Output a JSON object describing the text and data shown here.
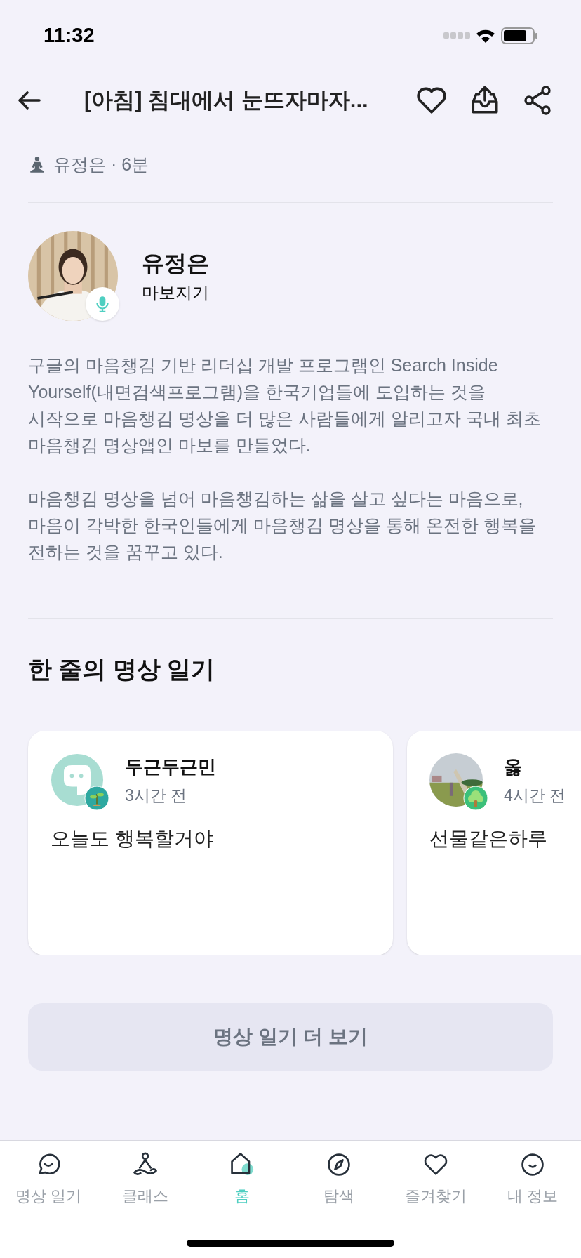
{
  "status_bar": {
    "time": "11:32"
  },
  "header": {
    "title": "[아침] 침대에서 눈뜨자마자..."
  },
  "meta": {
    "text": "유정은 · 6분"
  },
  "teacher": {
    "name": "유정은",
    "org": "마보지기"
  },
  "bio": [
    "구글의 마음챙김 기반 리더십 개발 프로그램인 Search Inside Yourself(내면검색프로그램)을 한국기업들에 도입하는 것을 시작으로 마음챙김 명상을 더 많은 사람들에게 알리고자 국내 최초 마음챙김 명상앱인 마보를 만들었다.",
    "마음챙김 명상을 넘어 마음챙김하는 삶을 살고 싶다는 마음으로, 마음이 각박한 한국인들에게 마음챙김 명상을 통해 온전한 행복을 전하는 것을 꿈꾸고 있다."
  ],
  "diary": {
    "title": "한 줄의 명상 일기",
    "entries": [
      {
        "user": "두근두근민",
        "time": "3시간 전",
        "text": "오늘도 행복할거야"
      },
      {
        "user": "옳",
        "time": "4시간 전",
        "text": "선물같은하루"
      }
    ],
    "more_button": "명상 일기 더 보기"
  },
  "tab_bar": [
    {
      "label": "명상 일기",
      "selected": false
    },
    {
      "label": "클래스",
      "selected": false
    },
    {
      "label": "홈",
      "selected": true
    },
    {
      "label": "탐색",
      "selected": false
    },
    {
      "label": "즐겨찾기",
      "selected": false
    },
    {
      "label": "내 정보",
      "selected": false
    }
  ]
}
